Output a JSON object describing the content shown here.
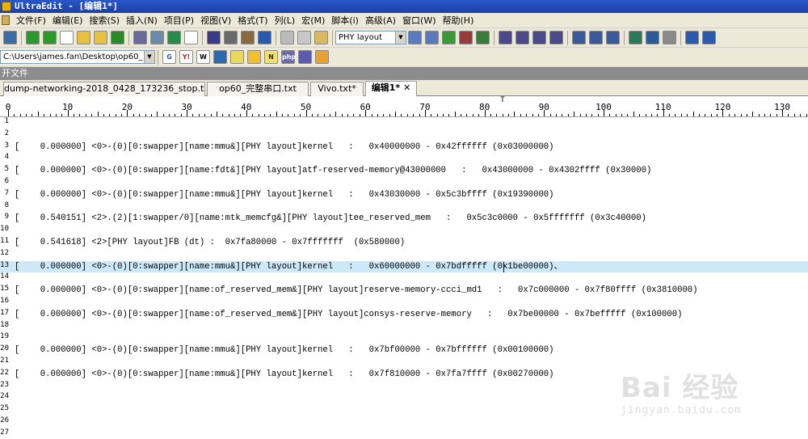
{
  "window": {
    "title": "UltraEdit - [编辑1*]"
  },
  "menu": [
    "文件(F)",
    "编辑(E)",
    "搜索(S)",
    "插入(N)",
    "项目(P)",
    "视图(V)",
    "格式(T)",
    "列(L)",
    "宏(M)",
    "脚本(i)",
    "高级(A)",
    "窗口(W)",
    "帮助(H)"
  ],
  "toolbar": {
    "search_combo_value": "PHY layout",
    "icons": [
      "new-window-icon",
      "back-icon",
      "forward-icon",
      "new-file-icon",
      "open-file-icon",
      "open-folder-icon",
      "save-icon",
      "print-icon",
      "print-preview-icon",
      "excel-icon",
      "document-icon",
      "list-icon",
      "binary-icon",
      "page-icon",
      "browser-icon",
      "cut-icon",
      "copy-icon",
      "paste-icon",
      "search-combo",
      "find-icon",
      "find-next-icon",
      "replace-icon",
      "find-in-files-icon",
      "goto-icon",
      "format-left-icon",
      "format-center-icon",
      "format-right-icon",
      "format-justify-icon",
      "window-horizontal-icon",
      "window-vertical-icon",
      "cascade-icon",
      "globe-icon",
      "browser-view-icon",
      "settings-icon",
      "info-icon",
      "help-icon"
    ]
  },
  "toolbar2": {
    "path_combo_value": "C:\\Users\\james.fan\\Desktop\\op60_",
    "icons": [
      "google-icon",
      "yahoo-icon",
      "wikipedia-icon",
      "stack-icon",
      "bulb-icon",
      "sun-icon",
      "n-icon",
      "php-icon",
      "links-icon",
      "windows-icon"
    ]
  },
  "filebar": {
    "label": "开文件"
  },
  "tabs": [
    {
      "label": "dump-networking-2018_0428_173236_stop.txt",
      "active": false
    },
    {
      "label": "op60_完整串口.txt",
      "active": false
    },
    {
      "label": "Vivo.txt*",
      "active": false
    },
    {
      "label": "编辑1*",
      "active": true,
      "close": "✕"
    }
  ],
  "ruler": {
    "labels": [
      "0",
      "10",
      "20",
      "30",
      "40",
      "50",
      "60",
      "70",
      "80",
      "90",
      "100",
      "110",
      "120",
      "130"
    ],
    "marker": "T"
  },
  "lines": [
    {
      "n": "1",
      "text": ""
    },
    {
      "n": "2",
      "text": ""
    },
    {
      "n": "3",
      "text": "[    0.000000] <0>-(0)[0:swapper][name:mmu&][PHY layout]kernel   :   0x40000000 - 0x42ffffff (0x03000000)"
    },
    {
      "n": "4",
      "text": ""
    },
    {
      "n": "5",
      "text": "[    0.000000] <0>-(0)[0:swapper][name:fdt&][PHY layout]atf-reserved-memory@43000000   :   0x43000000 - 0x4302ffff (0x30000)"
    },
    {
      "n": "6",
      "text": ""
    },
    {
      "n": "7",
      "text": "[    0.000000] <0>-(0)[0:swapper][name:mmu&][PHY layout]kernel   :   0x43030000 - 0x5c3bffff (0x19390000)"
    },
    {
      "n": "8",
      "text": ""
    },
    {
      "n": "9",
      "text": "[    0.540151] <2>.(2)[1:swapper/0][name:mtk_memcfg&][PHY layout]tee_reserved_mem   :   0x5c3c0000 - 0x5fffffff (0x3c40000)"
    },
    {
      "n": "10",
      "text": ""
    },
    {
      "n": "11",
      "text": "[    0.541618] <2>[PHY layout]FB (dt) :  0x7fa80000 - 0x7fffffff  (0x580000)"
    },
    {
      "n": "12",
      "text": ""
    },
    {
      "n": "13",
      "text": "[    0.000000] <0>-(0)[0:swapper][name:mmu&][PHY layout]kernel   :   0x60000000 - 0x7bdfffff (0x1be00000)、",
      "highlight": true
    },
    {
      "n": "14",
      "text": ""
    },
    {
      "n": "15",
      "text": "[    0.000000] <0>-(0)[0:swapper][name:of_reserved_mem&][PHY layout]reserve-memory-ccci_md1   :   0x7c000000 - 0x7f80ffff (0x3810000)"
    },
    {
      "n": "16",
      "text": ""
    },
    {
      "n": "17",
      "text": "[    0.000000] <0>-(0)[0:swapper][name:of_reserved_mem&][PHY layout]consys-reserve-memory   :   0x7be00000 - 0x7befffff (0x100000)"
    },
    {
      "n": "18",
      "text": ""
    },
    {
      "n": "19",
      "text": ""
    },
    {
      "n": "20",
      "text": "[    0.000000] <0>-(0)[0:swapper][name:mmu&][PHY layout]kernel   :   0x7bf00000 - 0x7bffffff (0x00100000)"
    },
    {
      "n": "21",
      "text": ""
    },
    {
      "n": "22",
      "text": "[    0.000000] <0>-(0)[0:swapper][name:mmu&][PHY layout]kernel   :   0x7f810000 - 0x7fa7ffff (0x00270000)"
    },
    {
      "n": "23",
      "text": ""
    },
    {
      "n": "24",
      "text": ""
    },
    {
      "n": "25",
      "text": ""
    },
    {
      "n": "26",
      "text": ""
    },
    {
      "n": "27",
      "text": ""
    }
  ],
  "watermark": {
    "brand": "Bai 经验",
    "url": "jingyan.baidu.com"
  },
  "colors": {
    "highlight_line": "#cde8f8",
    "titlebar": "#2b57c8",
    "chrome": "#ece9d8"
  }
}
